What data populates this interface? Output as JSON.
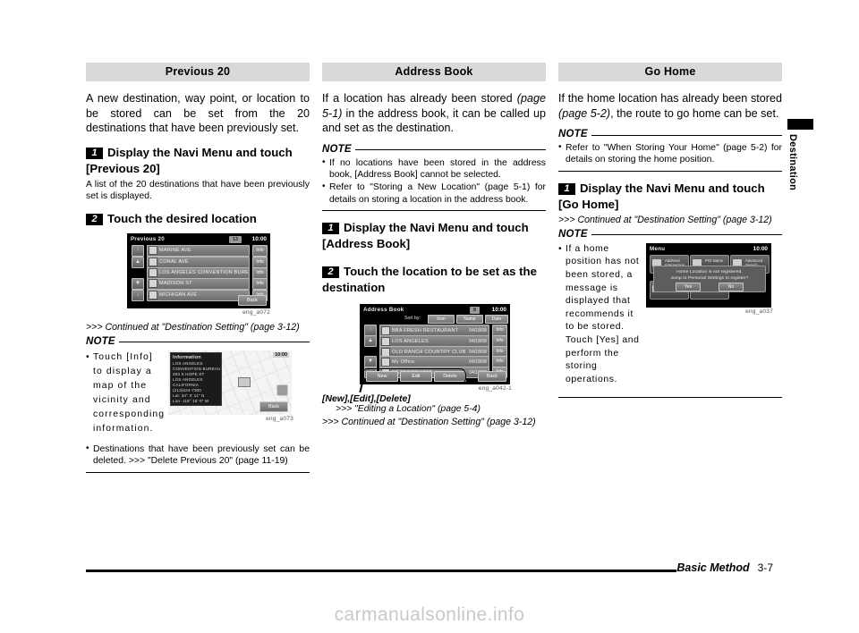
{
  "document": {
    "footer_section": "Basic Method",
    "footer_page": "3-7",
    "side_tab_label": "Destination",
    "watermark": "carmanualsonline.info"
  },
  "columns": [
    {
      "heading": "Previous 20",
      "intro": "A new destination, way point, or location to be stored can be set from the 20 destinations that have been previously set.",
      "step1_num": "1",
      "step1_text": "Display the Navi Menu and touch [Previous 20]",
      "step1_sub": "A list of the 20 destinations that have been previously set is displayed.",
      "step2_num": "2",
      "step2_text": "Touch the desired location",
      "screenshot_caption": "eng_a072",
      "continued": ">>> Continued at \"Destination Setting\" (page 3-12)",
      "note_title": "NOTE",
      "notes": [
        "Touch [Info] to display a map of the vicinity and corresponding information.",
        "Destinations that have been previously set can be deleted. >>> \"Delete Previous 20\" (page 11-19)"
      ],
      "note_caption": "eng_a073"
    },
    {
      "heading": "Address Book",
      "intro_a": "If a location has already been stored ",
      "intro_i": "(page 5-1)",
      "intro_b": " in the address book, it can be called up and set as the destination.",
      "note_title": "NOTE",
      "notes": [
        "If no locations have been stored in the address book, [Address Book] cannot be selected.",
        "Refer to \"Storing a New Location\" (page 5-1) for details on storing a location in the address book."
      ],
      "step1_num": "1",
      "step1_text": "Display the Navi Menu and touch [Address Book]",
      "step2_num": "2",
      "step2_text": "Touch the location to be set as the destination",
      "screenshot_caption": "eng_a042-1",
      "bracket_label": "[New],[Edit],[Delete]",
      "bracket_ref": ">>> \"Editing a Location\" (page 5-4)",
      "continued": ">>> Continued at \"Destination Setting\" (page 3-12)"
    },
    {
      "heading": "Go Home",
      "intro_a": "If the home location has already been stored ",
      "intro_i": "(page 5-2)",
      "intro_b": ", the route to go home can be set.",
      "note_title": "NOTE",
      "notes": [
        "Refer to \"When Storing Your Home\" (page 5-2) for details on storing the home position."
      ],
      "step1_num": "1",
      "step1_text": "Display the Navi Menu and touch [Go Home]",
      "continued": ">>> Continued at \"Destination Setting\" (page 3-12)",
      "note2_title": "NOTE",
      "note2_text": "If a home position has not been stored, a message is displayed that recommends it to be stored. Touch [Yes] and perform the storing operations.",
      "screenshot_caption": "eng_a037"
    }
  ],
  "screens": {
    "previous20": {
      "title": "Previous 20",
      "count": "13",
      "clock": "10:00",
      "back_label": "Back",
      "info_label": "Info",
      "rows": [
        {
          "name": "MARINE AVE"
        },
        {
          "name": "CORAL AVE"
        },
        {
          "name": "LOS ANGELES CONVENTION BUREAU"
        },
        {
          "name": "MADISON ST"
        },
        {
          "name": "MICHIGAN AVE"
        }
      ],
      "scroll_buttons": [
        "↑",
        "▲",
        "▼",
        "↓"
      ]
    },
    "information": {
      "title": "Information",
      "clock": "10:00",
      "back_label": "Back",
      "lines": [
        "LOS ANGELES",
        "   CONVENTION BUREAU",
        "303 S HOPE ST",
        "LOS ANGELES",
        "CALIFORNIA",
        "(213)624-7300",
        "Lat:   34°  3' 11\" N",
        "Lon: 118° 16'  0\" W"
      ]
    },
    "addressbook": {
      "title": "Address Book",
      "count": "8",
      "clock": "10:00",
      "sort_label": "Sort by:",
      "sort_buttons": [
        "Icon",
        "Name",
        "Date"
      ],
      "info_label": "Info",
      "back_label": "Back",
      "bottom_buttons": [
        "New",
        "Edit",
        "Delete"
      ],
      "rows": [
        {
          "name": "BBA FRESH RESTAURANT",
          "date": "04/18/08"
        },
        {
          "name": "LOS ANGELES",
          "date": "04/18/08"
        },
        {
          "name": "OLD RANCH COUNTRY CLUB",
          "date": "04/18/08"
        },
        {
          "name": "My Office",
          "date": "04/18/08"
        },
        {
          "name": "METROPOLITAN",
          "date": "04/18/08"
        }
      ],
      "scroll_buttons": [
        "↑",
        "▲",
        "▼",
        "↓"
      ]
    },
    "menu": {
      "title": "Menu",
      "clock": "10:00",
      "tiles": [
        "Address/ Intersection",
        "POI Name",
        "Advanced Search",
        "Settings",
        "Tools"
      ],
      "dialog_line1": "Home Location is not registered.",
      "dialog_line2": "Jump to Personal Settings to register?",
      "yes_label": "Yes",
      "no_label": "No"
    }
  }
}
